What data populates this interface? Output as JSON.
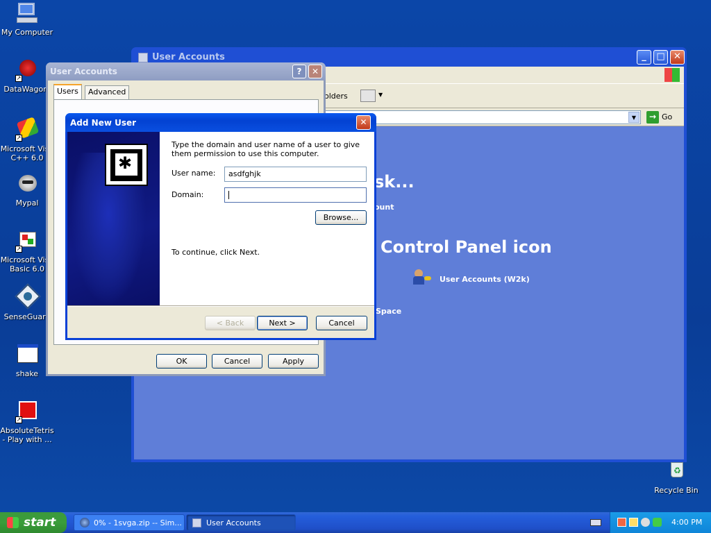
{
  "desktop": {
    "icons": [
      {
        "label": "My Computer"
      },
      {
        "label": "DataWagon."
      },
      {
        "label": "Microsoft Visu C++ 6.0"
      },
      {
        "label": "Mypal"
      },
      {
        "label": "Microsoft Visu Basic 6.0"
      },
      {
        "label": "SenseGuard"
      },
      {
        "label": "shake"
      },
      {
        "label": "AbsoluteTetris - Play with ..."
      },
      {
        "label": "Recycle Bin"
      }
    ]
  },
  "control_panel": {
    "title": "User Accounts",
    "toolbar_folders": "olders",
    "go_label": "Go",
    "heading1": "sk...",
    "link1": "ount",
    "heading2": "Control Panel icon",
    "link_w2k": "User Accounts (W2k)",
    "link_space": "Space"
  },
  "ua_dialog": {
    "title": "User Accounts",
    "tabs": [
      "Users",
      "Advanced"
    ],
    "ok": "OK",
    "cancel": "Cancel",
    "apply": "Apply"
  },
  "add_user": {
    "title": "Add New User",
    "intro": "Type the domain and user name of a user to give them permission to use this computer.",
    "username_label": "User name:",
    "username_value": "asdfghjk",
    "domain_label": "Domain:",
    "domain_value": "",
    "browse": "Browse...",
    "continue_text": "To continue, click Next.",
    "back": "< Back",
    "next": "Next >",
    "cancel": "Cancel"
  },
  "taskbar": {
    "start": "start",
    "buttons": [
      {
        "label": "0% - 1svga.zip -- Sim..."
      },
      {
        "label": "User Accounts"
      }
    ],
    "clock": "4:00 PM"
  }
}
